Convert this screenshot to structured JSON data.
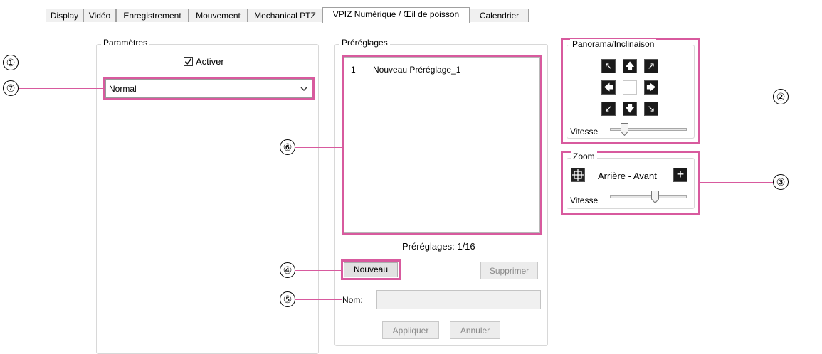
{
  "tabs": [
    {
      "label": "Display"
    },
    {
      "label": "Vidéo"
    },
    {
      "label": "Enregistrement"
    },
    {
      "label": "Mouvement"
    },
    {
      "label": "Mechanical PTZ"
    },
    {
      "label": "VPIZ Numérique / Œil de poisson",
      "active": true
    },
    {
      "label": "Calendrier"
    }
  ],
  "parametres": {
    "legend": "Paramètres",
    "activer_label": "Activer",
    "activer_checked": true,
    "mode_value": "Normal"
  },
  "preglages": {
    "legend": "Préréglages",
    "list": [
      {
        "index": "1",
        "name": "Nouveau Préréglage_1"
      }
    ],
    "count_label": "Préréglages:",
    "count_value": "1/16",
    "nouveau_label": "Nouveau",
    "supprimer_label": "Supprimer",
    "nom_label": "Nom:",
    "nom_value": "",
    "appliquer_label": "Appliquer",
    "annuler_label": "Annuler"
  },
  "panorama": {
    "legend": "Panorama/Inclinaison",
    "vitesse_label": "Vitesse",
    "speed_fraction": 0.15
  },
  "zoom": {
    "legend": "Zoom",
    "range_label": "Arrière - Avant",
    "vitesse_label": "Vitesse",
    "speed_fraction": 0.6
  },
  "callouts": [
    "①",
    "②",
    "③",
    "④",
    "⑤",
    "⑥",
    "⑦"
  ],
  "colors": {
    "highlight": "#d85a9e"
  },
  "icons": {
    "arrows": [
      "arrow-up-left-icon",
      "arrow-up-icon",
      "arrow-up-right-icon",
      "arrow-left-icon",
      "arrow-right-icon",
      "arrow-down-left-icon",
      "arrow-down-icon",
      "arrow-down-right-icon"
    ]
  }
}
